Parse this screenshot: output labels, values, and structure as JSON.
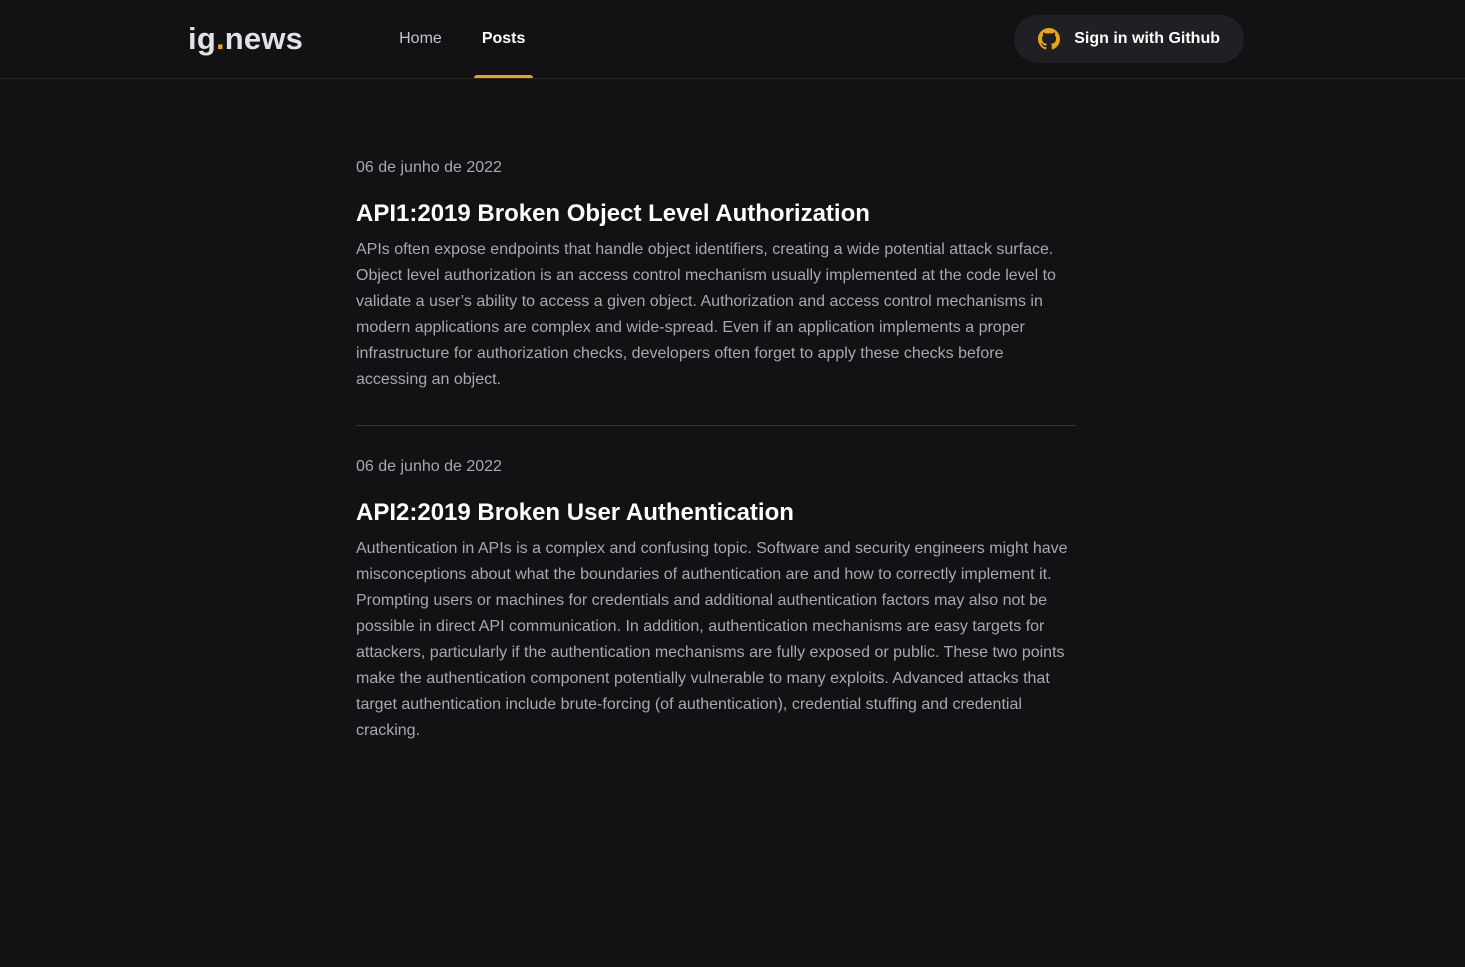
{
  "header": {
    "logo_main": "ig",
    "logo_dot": ".",
    "logo_suffix": "news",
    "nav": [
      {
        "label": "Home",
        "active": false
      },
      {
        "label": "Posts",
        "active": true
      }
    ],
    "signin_label": "Sign in with Github",
    "signin_icon": "github-icon"
  },
  "colors": {
    "background": "#121214",
    "accent": "#eba417",
    "text_muted": "#a8a8b3",
    "button_bg": "#202024"
  },
  "posts": [
    {
      "date": "06 de junho de 2022",
      "title": "API1:2019 Broken Object Level Authorization",
      "excerpt": "APIs often expose endpoints that handle object identifiers, creating a wide potential attack surface. Object level authorization is an access control mechanism usually implemented at the code level to validate a user’s ability to access a given object. Authorization and access control mechanisms in modern applications are complex and wide-spread. Even if an application implements a proper infrastructure for authorization checks, developers often forget to apply these checks before accessing an object."
    },
    {
      "date": "06 de junho de 2022",
      "title": "API2:2019 Broken User Authentication",
      "excerpt": "Authentication in APIs is a complex and confusing topic. Software and security engineers might have misconceptions about what the boundaries of authentication are and how to correctly implement it. Prompting users or machines for credentials and additional authentication factors may also not be possible in direct API communication. In addition, authentication mechanisms are easy targets for attackers, particularly if the authentication mechanisms are fully exposed or public. These two points make the authentication component potentially vulnerable to many exploits. Advanced attacks that target authentication include brute-forcing (of authentication), credential stuffing and credential cracking."
    }
  ]
}
